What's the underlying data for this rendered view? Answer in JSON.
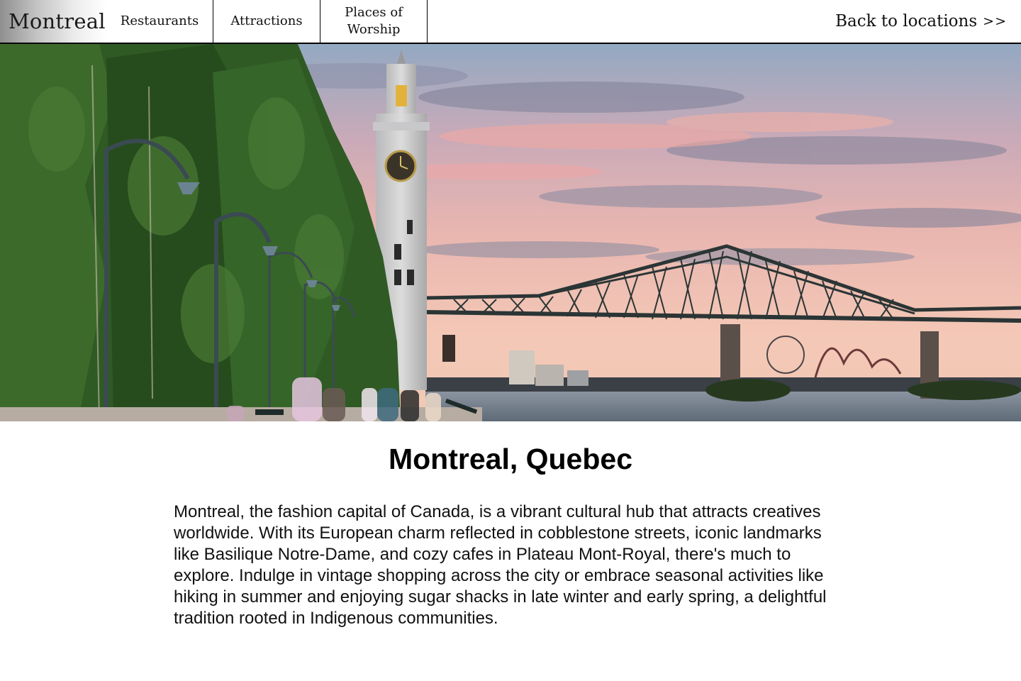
{
  "nav": {
    "brand": "Montreal",
    "tabs": [
      {
        "label": "Restaurants"
      },
      {
        "label": "Attractions"
      },
      {
        "label": "Places of Worship"
      }
    ],
    "back_label": "Back to locations",
    "back_arrows": ">>"
  },
  "hero": {
    "image_subject": "Montreal Clock Tower and Jacques Cartier Bridge at sunset from the Old Port promenade"
  },
  "page": {
    "title": "Montreal, Quebec",
    "description": "Montreal, the fashion capital of Canada, is a vibrant cultural hub that attracts creatives worldwide. With its European charm reflected in cobblestone streets, iconic landmarks like Basilique Notre-Dame, and cozy cafes in Plateau Mont-Royal, there's much to explore. Indulge in vintage shopping across the city or embrace seasonal activities like hiking in summer and enjoying sugar shacks in late winter and early spring, a delightful tradition rooted in Indigenous communities."
  },
  "colors": {
    "sky_top": "#9fb3c8",
    "sky_pink": "#f2b7ad",
    "bridge": "#2f3a3a",
    "trees": "#2e5a22",
    "water": "#6c7a86"
  }
}
